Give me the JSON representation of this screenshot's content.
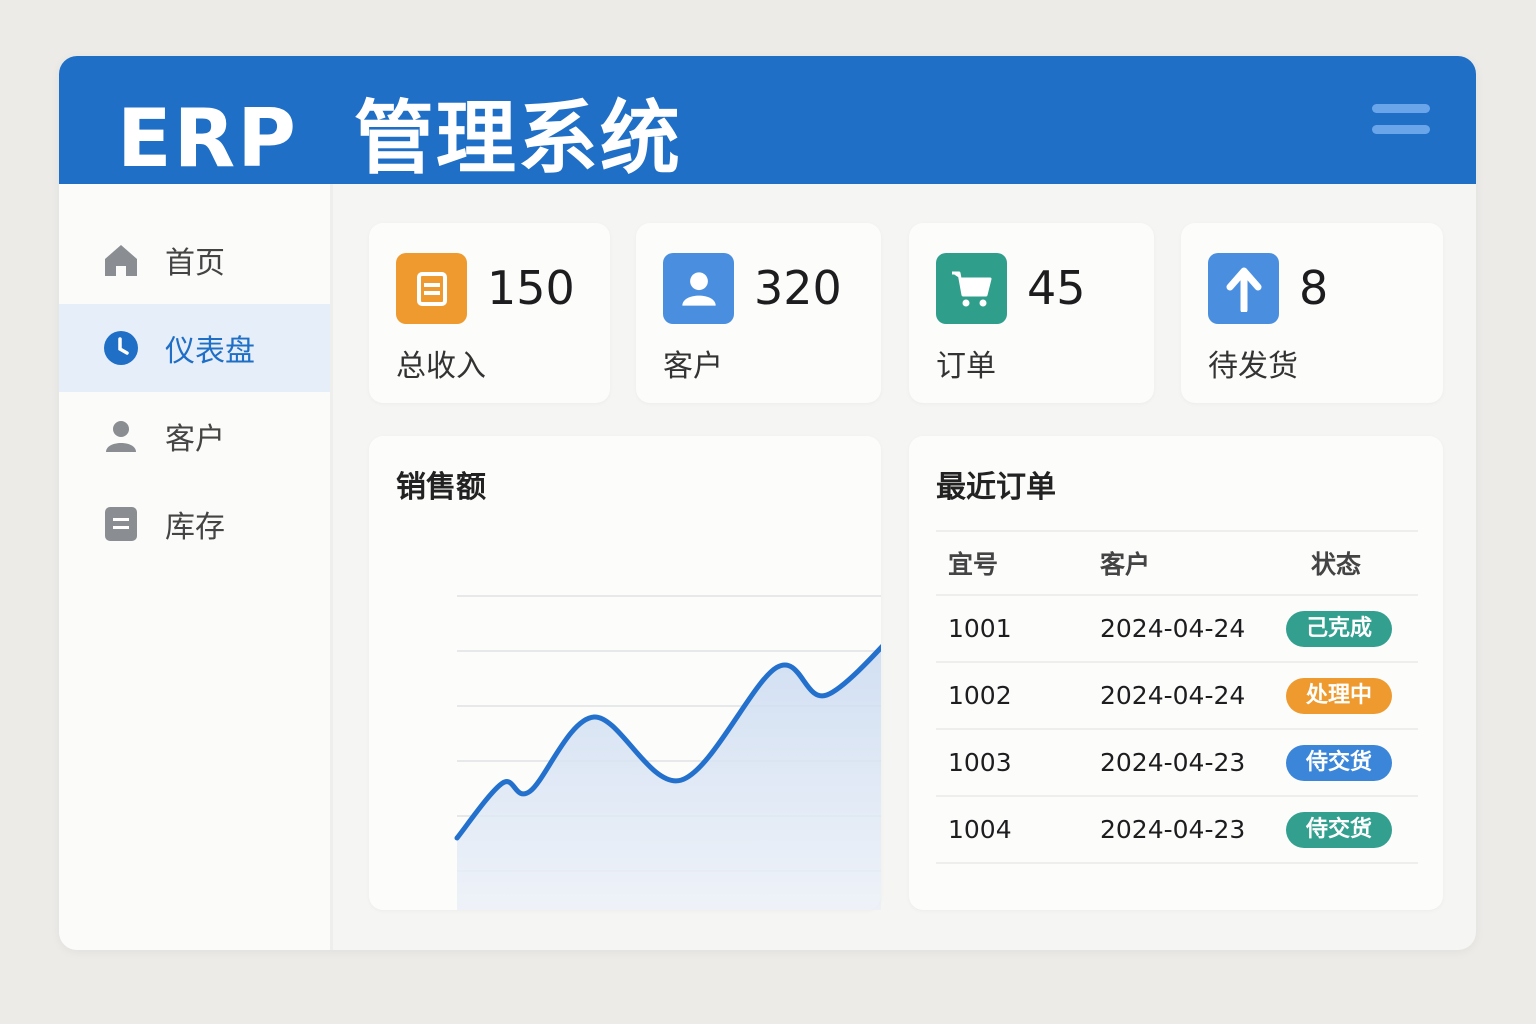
{
  "header": {
    "title_en": "ERP",
    "title_cn": "管理系统",
    "menu_icon": "hamburger-icon"
  },
  "sidebar": {
    "items": [
      {
        "label": "首页",
        "icon": "home-icon"
      },
      {
        "label": "仪表盘",
        "icon": "clock-icon",
        "active": true
      },
      {
        "label": "客户",
        "icon": "user-icon"
      },
      {
        "label": "库存",
        "icon": "document-icon"
      }
    ]
  },
  "stats": [
    {
      "value": "150",
      "label": "总收入",
      "icon": "ledger-icon",
      "color": "#ee9a2e"
    },
    {
      "value": "320",
      "label": "客户",
      "icon": "user-icon",
      "color": "#4a8fdf"
    },
    {
      "value": "45",
      "label": "订单",
      "icon": "cart-icon",
      "color": "#2f9f8c"
    },
    {
      "value": "8",
      "label": "待发货",
      "icon": "arrow-up-icon",
      "color": "#4a8fdf"
    }
  ],
  "sales": {
    "title": "销售额"
  },
  "chart_data": {
    "type": "area",
    "title": "销售额",
    "xlabel": "",
    "ylabel": "",
    "x": [
      0,
      1,
      1.6,
      3,
      4.9,
      7,
      8.1,
      9.9
    ],
    "values": [
      1.6,
      2.6,
      2.45,
      3.8,
      2.65,
      4.7,
      4.2,
      5.6
    ],
    "ylim": [
      0,
      6
    ],
    "grid": true
  },
  "orders": {
    "title": "最近订单",
    "columns": [
      "宜号",
      "客户",
      "状态"
    ],
    "rows": [
      {
        "id": "1001",
        "date": "2024-04-24",
        "status": "己克成",
        "color": "#33a08f"
      },
      {
        "id": "1002",
        "date": "2024-04-24",
        "status": "处理中",
        "color": "#ee9a2e"
      },
      {
        "id": "1003",
        "date": "2024-04-23",
        "status": "侍交货",
        "color": "#3c86da"
      },
      {
        "id": "1004",
        "date": "2024-04-23",
        "status": "侍交货",
        "color": "#33a08f"
      }
    ]
  }
}
